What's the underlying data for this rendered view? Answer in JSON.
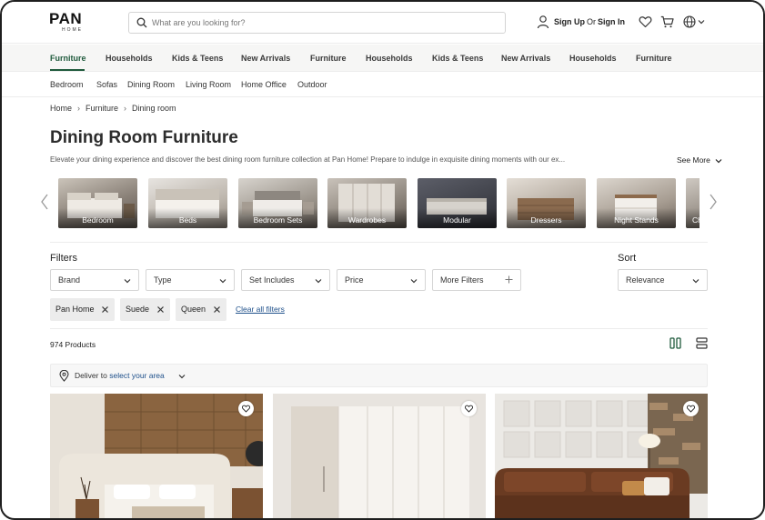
{
  "header": {
    "logo_main": "PAN",
    "logo_sub": "HOME",
    "search_placeholder": "What are you looking for?",
    "sign_up": "Sign Up",
    "or": "Or",
    "sign_in": "Sign In"
  },
  "category_nav": [
    {
      "label": "Furniture",
      "active": true
    },
    {
      "label": "Households"
    },
    {
      "label": "Kids & Teens"
    },
    {
      "label": "New Arrivals"
    },
    {
      "label": "Furniture"
    },
    {
      "label": "Households"
    },
    {
      "label": "Kids & Teens"
    },
    {
      "label": "New Arrivals"
    },
    {
      "label": "Households"
    },
    {
      "label": "Furniture"
    }
  ],
  "sub_nav": [
    "Bedroom",
    "Sofas",
    "Dining Room",
    "Living Room",
    "Home Office",
    "Outdoor"
  ],
  "breadcrumb": [
    "Home",
    "Furniture",
    "Dining room"
  ],
  "page": {
    "title": "Dining Room Furniture",
    "description": "Elevate your dining experience and discover the best dining room furniture collection at Pan Home! Prepare to indulge in exquisite dining moments with our ex...",
    "see_more": "See More"
  },
  "categories": [
    "Bedroom",
    "Beds",
    "Bedroom Sets",
    "Wardrobes",
    "Modular",
    "Dressers",
    "Night Stands",
    "Chests"
  ],
  "filters": {
    "title": "Filters",
    "dropdowns": [
      "Brand",
      "Type",
      "Set Includes",
      "Price",
      "More Filters"
    ],
    "sort_title": "Sort",
    "sort_value": "Relevance",
    "active_chips": [
      "Pan Home",
      "Suede",
      "Queen"
    ],
    "clear_all": "Clear all filters"
  },
  "results": {
    "count_text": "974 Products"
  },
  "deliver": {
    "prefix": "Deliver to",
    "link": "select your area"
  },
  "colors": {
    "accent_green": "#1f5a3c",
    "link_blue": "#1d4f8a"
  }
}
